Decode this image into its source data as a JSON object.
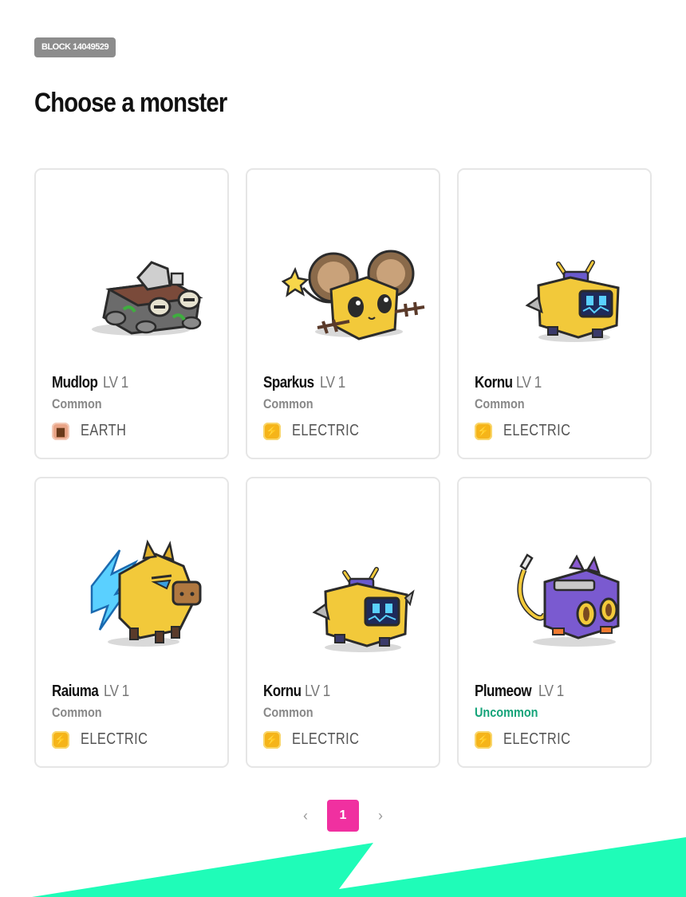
{
  "header": {
    "block_badge": "BLOCK 14049529",
    "title": "Choose a monster"
  },
  "monsters": [
    {
      "name": "Mudlop",
      "level": "LV 1",
      "rarity": "Common",
      "element": "EARTH",
      "element_icon": "earth-icon",
      "art": "mudlop-illustration"
    },
    {
      "name": "Sparkus",
      "level": "LV 1",
      "rarity": "Common",
      "element": "ELECTRIC",
      "element_icon": "electric-icon",
      "art": "sparkus-illustration"
    },
    {
      "name": "Kornu",
      "level": "LV 1",
      "rarity": "Common",
      "element": "ELECTRIC",
      "element_icon": "electric-icon",
      "art": "kornu-illustration"
    },
    {
      "name": "Raiuma",
      "level": "LV 1",
      "rarity": "Common",
      "element": "ELECTRIC",
      "element_icon": "electric-icon",
      "art": "raiuma-illustration"
    },
    {
      "name": "Kornu",
      "level": "LV 1",
      "rarity": "Common",
      "element": "ELECTRIC",
      "element_icon": "electric-icon",
      "art": "kornu-illustration"
    },
    {
      "name": "Plumeow",
      "level": "LV 1",
      "rarity": "Uncommon",
      "element": "ELECTRIC",
      "element_icon": "electric-icon",
      "art": "plumeow-illustration"
    }
  ],
  "pagination": {
    "current_page": "1",
    "prev_icon": "chevron-left-icon",
    "next_icon": "chevron-right-icon"
  },
  "colors": {
    "accent_pink": "#f030a0",
    "accent_mint": "#1ffcb8",
    "uncommon_green": "#16a47a",
    "electric_yellow": "#f5b41a",
    "earth_tan": "#e9a487"
  }
}
